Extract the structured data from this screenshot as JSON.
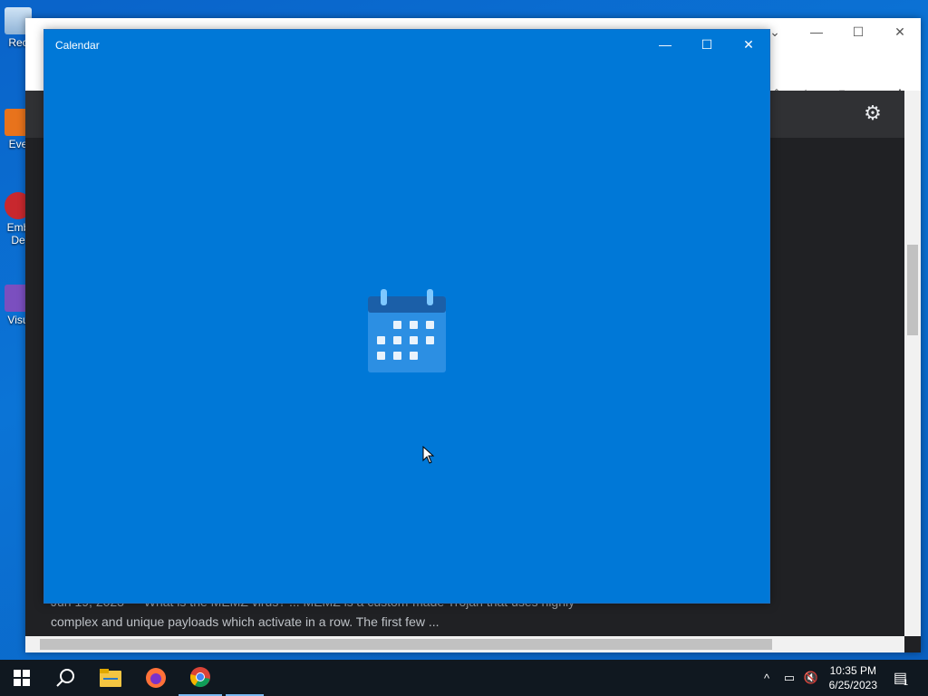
{
  "desktop": {
    "icons": [
      {
        "label": "Rec",
        "icon": "recycle-bin-icon"
      },
      {
        "label": "Eve",
        "icon": "app-shortcut-icon"
      },
      {
        "label": "Emb",
        "label2": "De",
        "icon": "app-shortcut-icon"
      },
      {
        "label": "Visu",
        "icon": "visual-studio-icon"
      }
    ]
  },
  "browser": {
    "snippet_line1": "Jun 19, 2023 — What is the MEMZ virus? ... MEMZ is a custom-made Trojan that uses highly",
    "snippet_line2": "complex and unique payloads which activate in a row. The first few ..."
  },
  "calendar_window": {
    "title": "Calendar",
    "background": "#0078d7",
    "splash_icon": "calendar-icon"
  },
  "taskbar": {
    "items": [
      "start-icon",
      "search-icon",
      "file-explorer-icon",
      "firefox-icon",
      "chrome-icon"
    ],
    "clock_time": "10:35 PM",
    "clock_date": "6/25/2023",
    "notification_count": "1"
  }
}
